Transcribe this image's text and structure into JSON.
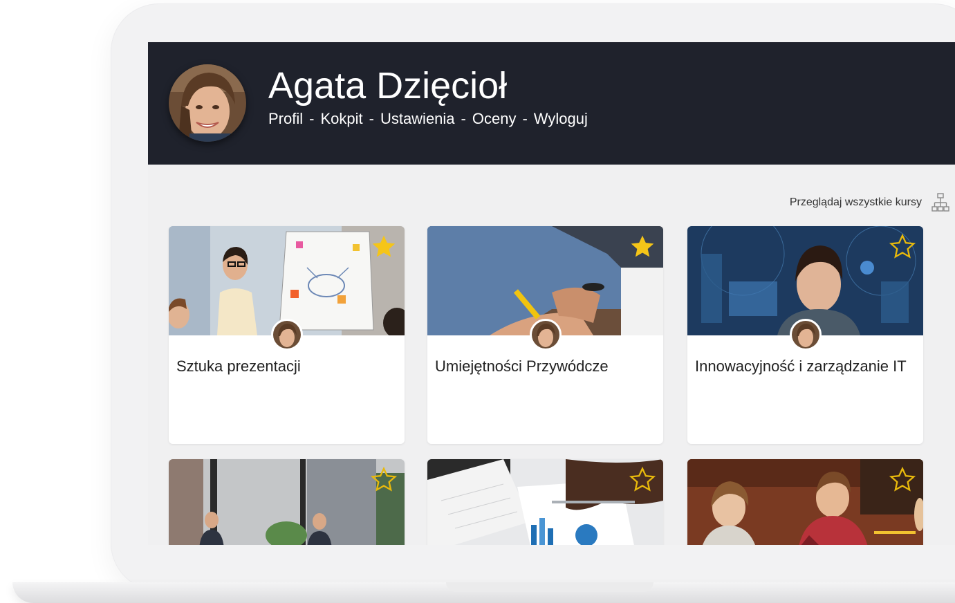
{
  "user": {
    "name": "Agata Dzięcioł"
  },
  "nav": {
    "items": [
      "Profil",
      "Kokpit",
      "Ustawienia",
      "Oceny",
      "Wyloguj"
    ],
    "separator": "-"
  },
  "browse": {
    "label": "Przeglądaj wszystkie kursy",
    "icon": "sitemap-icon"
  },
  "courses": [
    {
      "title": "Sztuka prezentacji",
      "favorite": true
    },
    {
      "title": "Umiejętności Przywódcze",
      "favorite": true
    },
    {
      "title": "Innowacyjność i zarządzanie IT",
      "favorite": false
    },
    {
      "title": "",
      "favorite": false
    },
    {
      "title": "",
      "favorite": false
    },
    {
      "title": "",
      "favorite": false
    }
  ],
  "colors": {
    "header_bg": "#1f222c",
    "star_filled": "#f5c518",
    "star_outline": "#e8b90c",
    "screen_bg": "#f0f0f1"
  }
}
